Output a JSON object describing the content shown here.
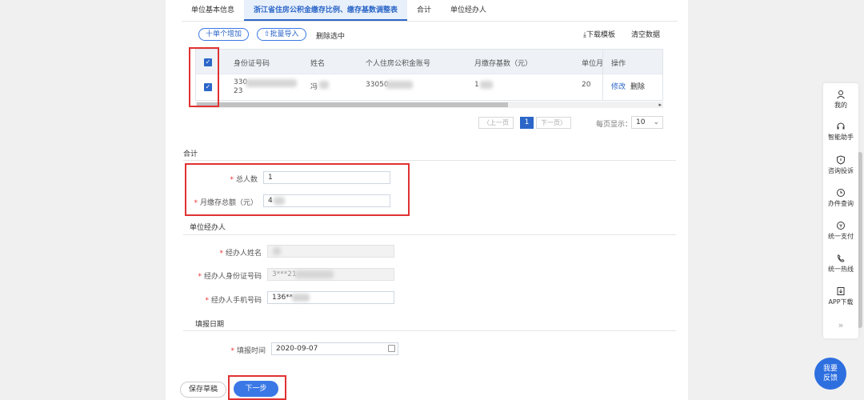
{
  "tabs": [
    {
      "label": "单位基本信息"
    },
    {
      "label": "浙江省住房公积金缴存比例、缴存基数调整表"
    },
    {
      "label": "合计"
    },
    {
      "label": "单位经办人"
    }
  ],
  "toolbar": {
    "add_single": "十单个增加",
    "batch_import": "⇧批量导入",
    "delete_selected": "删除选中",
    "download_template": "⤓下载模板",
    "clear_data": "清空数据"
  },
  "table": {
    "headers": [
      "身份证号码",
      "姓名",
      "个人住房公积金账号",
      "月缴存基数（元）",
      "单位月缴",
      "操作"
    ],
    "row": {
      "id_number": "330",
      "id_number_tail": "23",
      "name": "冯",
      "account": "33050",
      "base": "1",
      "unit_monthly": "20",
      "edit": "修改",
      "delete": "删除"
    }
  },
  "pager": {
    "prev": "〈上一页",
    "page": "1",
    "next": "下一页〉",
    "per_page_label": "每页显示：",
    "per_page_value": "10"
  },
  "summary": {
    "title": "合计",
    "total_people_label": "总人数",
    "total_people_value": "1",
    "total_amount_label": "月缴存总额（元）",
    "total_amount_value": "4"
  },
  "handler": {
    "title": "单位经办人",
    "name_label": "经办人姓名",
    "id_label": "经办人身份证号码",
    "id_value": "3***21",
    "phone_label": "经办人手机号码",
    "phone_value": "136**"
  },
  "fill_date": {
    "title": "填报日期",
    "time_label": "填报时间",
    "time_value": "2020-09-07"
  },
  "actions": {
    "save_draft": "保存草稿",
    "next": "下一步"
  },
  "sidebar": [
    {
      "label": "我的",
      "icon": "user-icon"
    },
    {
      "label": "智能助手",
      "icon": "headset-icon"
    },
    {
      "label": "咨询投诉",
      "icon": "shield-icon"
    },
    {
      "label": "办件查询",
      "icon": "clock-icon"
    },
    {
      "label": "统一支付",
      "icon": "yen-icon"
    },
    {
      "label": "统一热线",
      "icon": "phone-icon"
    },
    {
      "label": "APP下载",
      "icon": "download-icon"
    },
    {
      "label": "»",
      "icon": "chevron-right-icon"
    }
  ],
  "feedback": {
    "line1": "我要",
    "line2": "反馈"
  },
  "colors": {
    "accent": "#2b66c8",
    "highlight_box": "#e03232"
  }
}
